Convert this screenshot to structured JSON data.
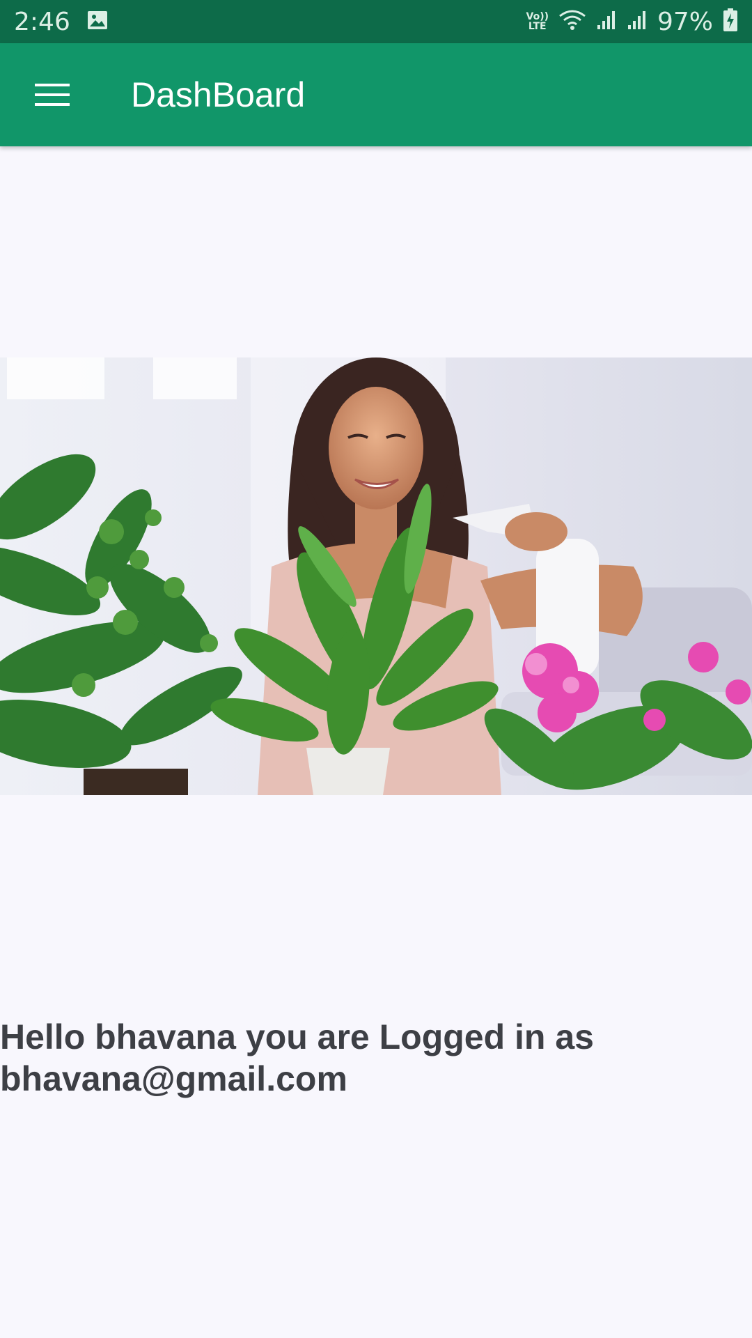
{
  "status_bar": {
    "time": "2:46",
    "battery": "97%",
    "network_label": "Vo)) LTE",
    "icons": [
      "image-notification-icon",
      "volte-icon",
      "wifi-icon",
      "signal-icon",
      "signal-icon",
      "battery-charging-icon"
    ]
  },
  "app_bar": {
    "title": "DashBoard",
    "menu_icon": "hamburger-menu-icon",
    "background_color": "#119669"
  },
  "hero_image": {
    "description": "woman-watering-houseplants-photo"
  },
  "greeting": {
    "line1": "Hello bhavana you are Logged in as",
    "line2": "bhavana@gmail.com"
  },
  "colors": {
    "status_bar": "#0d6b49",
    "app_bar": "#119669",
    "background": "#f8f7fd",
    "text": "#3d3f45"
  }
}
